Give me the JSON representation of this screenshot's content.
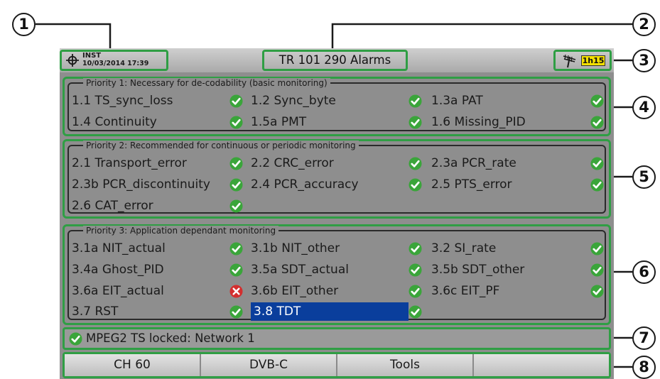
{
  "header": {
    "mode_label": "INST",
    "datetime": "10/03/2014 17:39",
    "title": "TR 101 290 Alarms",
    "battery": "1h15",
    "icons": [
      "target-icon",
      "antenna-icon",
      "battery-icon"
    ]
  },
  "groups": [
    {
      "title": "Priority 1: Necessary for de-codability (basic monitoring)",
      "rows": [
        [
          {
            "label": "1.1 TS_sync_loss",
            "status": "ok"
          },
          {
            "label": "1.2 Sync_byte",
            "status": "ok"
          },
          {
            "label": "1.3a PAT",
            "status": "ok"
          }
        ],
        [
          {
            "label": "1.4 Continuity",
            "status": "ok"
          },
          {
            "label": "1.5a PMT",
            "status": "ok"
          },
          {
            "label": "1.6 Missing_PID",
            "status": "ok"
          }
        ]
      ]
    },
    {
      "title": "Priority 2: Recommended for continuous or periodic monitoring",
      "rows": [
        [
          {
            "label": "2.1 Transport_error",
            "status": "ok"
          },
          {
            "label": "2.2 CRC_error",
            "status": "ok"
          },
          {
            "label": "2.3a PCR_rate",
            "status": "ok"
          }
        ],
        [
          {
            "label": "2.3b PCR_discontinuity",
            "status": "ok"
          },
          {
            "label": "2.4 PCR_accuracy",
            "status": "ok"
          },
          {
            "label": "2.5 PTS_error",
            "status": "ok"
          }
        ],
        [
          {
            "label": "2.6 CAT_error",
            "status": "ok"
          }
        ]
      ]
    },
    {
      "title": "Priority 3: Application dependant monitoring",
      "rows": [
        [
          {
            "label": "3.1a NIT_actual",
            "status": "ok"
          },
          {
            "label": "3.1b NIT_other",
            "status": "ok"
          },
          {
            "label": "3.2 SI_rate",
            "status": "ok"
          }
        ],
        [
          {
            "label": "3.4a Ghost_PID",
            "status": "ok"
          },
          {
            "label": "3.5a SDT_actual",
            "status": "ok"
          },
          {
            "label": "3.5b SDT_other",
            "status": "ok"
          }
        ],
        [
          {
            "label": "3.6a EIT_actual",
            "status": "error"
          },
          {
            "label": "3.6b EIT_other",
            "status": "ok"
          },
          {
            "label": "3.6c EIT_PF",
            "status": "ok"
          }
        ],
        [
          {
            "label": "3.7 RST",
            "status": "ok"
          },
          {
            "label": "3.8 TDT",
            "status": "ok",
            "selected": true
          }
        ]
      ]
    }
  ],
  "status_bar": {
    "text": "MPEG2 TS locked: Network 1",
    "status": "ok"
  },
  "softkeys": [
    "CH 60",
    "DVB-C",
    "Tools",
    ""
  ],
  "callouts": [
    "1",
    "2",
    "3",
    "4",
    "5",
    "6",
    "7",
    "8"
  ],
  "colors": {
    "highlight": "#2f9e44",
    "ok": "#3aa53a",
    "error": "#d32f2f",
    "selected": "#0a3e9c",
    "battery": "#f5e000"
  }
}
